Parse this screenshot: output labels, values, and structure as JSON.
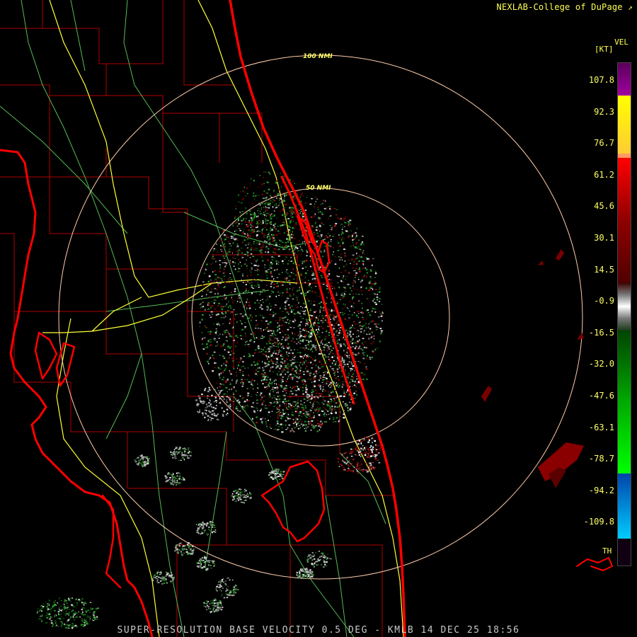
{
  "header": {
    "credit": "NEXLAB-College of DuPage",
    "credit_icon": "external-link-icon"
  },
  "footer": {
    "product": "SUPER-RESOLUTION BASE VELOCITY 0.5 DEG - KMLB 14 DEC 25 18:56"
  },
  "legend": {
    "title": "VEL",
    "unit": "[KT]",
    "threshold_label": "TH",
    "ticks": [
      "107.8",
      "92.3",
      "76.7",
      "61.2",
      "45.6",
      "30.1",
      "14.5",
      "-0.9",
      "-16.5",
      "-32.0",
      "-47.6",
      "-63.1",
      "-78.7",
      "-94.2",
      "-109.8"
    ],
    "colors": {
      "purple": "#7a007a",
      "yellow": "#ffff00",
      "orange": "#ff9933",
      "red": "#ff0000",
      "dark_red": "#600000",
      "gray": "#aaaaaa",
      "green": "#00aa00",
      "bright_green": "#00ff00",
      "blue": "#0066cc",
      "cyan": "#00ccff"
    }
  },
  "map": {
    "radar_site": "KMLB",
    "range_rings": [
      {
        "label": "100 NMI"
      },
      {
        "label": "50 NMI"
      }
    ],
    "colors": {
      "coastline": "#ff0000",
      "county_lines": "#b40000",
      "highways": "#ffff33",
      "roads": "#66cc66",
      "range_rings": "#ffccaa",
      "background": "#000000"
    }
  }
}
